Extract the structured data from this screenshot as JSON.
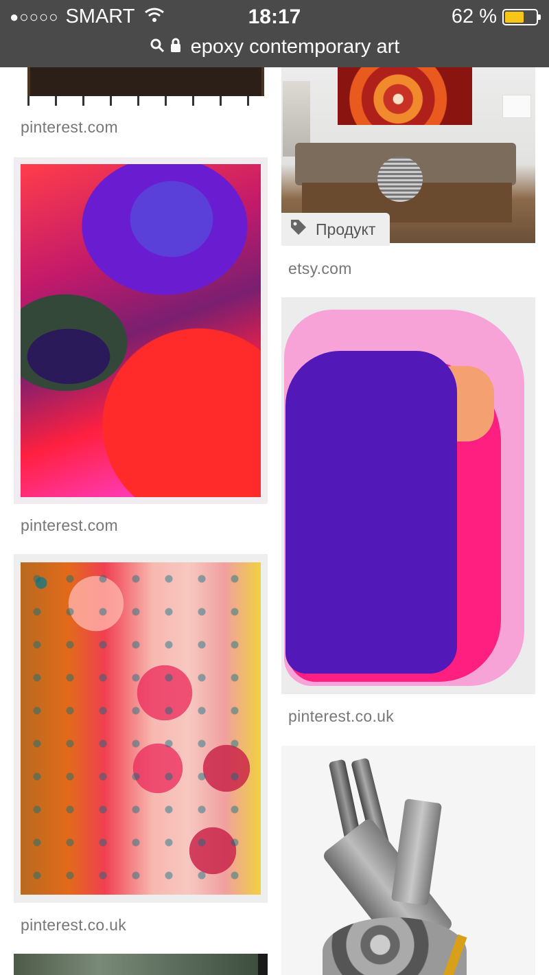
{
  "status_bar": {
    "signal_dots": "●○○○○",
    "carrier": "SMART",
    "time": "18:17",
    "battery_percent": "62 %",
    "battery_level": 0.62
  },
  "url_bar": {
    "query": "epoxy contemporary art"
  },
  "results": {
    "left": [
      {
        "source": "pinterest.com"
      },
      {
        "source": "pinterest.com"
      },
      {
        "source": "pinterest.co.uk"
      }
    ],
    "right": [
      {
        "source": "etsy.com",
        "badge": "Продукт"
      },
      {
        "source": "pinterest.co.uk"
      }
    ]
  },
  "colors": {
    "status_bar_bg": "#4a4a4a",
    "battery_fill": "#f5c518",
    "source_text": "#777777"
  }
}
